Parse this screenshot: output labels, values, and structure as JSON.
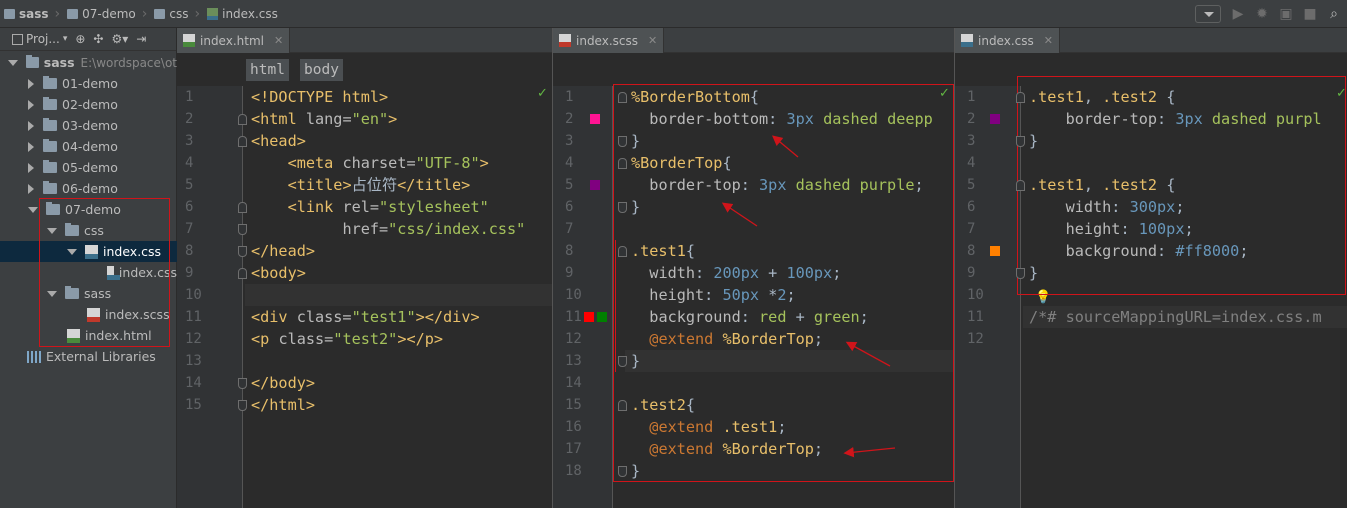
{
  "breadcrumbs": [
    "sass",
    "07-demo",
    "css",
    "index.css"
  ],
  "project": {
    "view_label": "Proj...",
    "root_name": "sass",
    "root_path": "E:\\wordspace\\ot",
    "nodes": [
      "01-demo",
      "02-demo",
      "03-demo",
      "04-demo",
      "05-demo",
      "06-demo",
      "07-demo",
      "css",
      "index.css",
      "index.css",
      "sass",
      "index.scss",
      "index.html",
      "External Libraries"
    ]
  },
  "html_editor": {
    "tab": "index.html",
    "tags": [
      "html",
      "body"
    ],
    "lines": [
      [
        [
          "tg",
          "<!DOCTYPE html>"
        ]
      ],
      [
        [
          "tg",
          "<html "
        ],
        [
          "at",
          "lang="
        ],
        [
          "st",
          "\"en\""
        ],
        [
          "tg",
          ">"
        ]
      ],
      [
        [
          "tg",
          "<head>"
        ]
      ],
      [
        [
          "sp",
          "    "
        ],
        [
          "tg",
          "<meta "
        ],
        [
          "at",
          "charset="
        ],
        [
          "st",
          "\"UTF-8\""
        ],
        [
          "tg",
          ">"
        ]
      ],
      [
        [
          "sp",
          "    "
        ],
        [
          "tg",
          "<title>"
        ],
        [
          "pl",
          "占位符"
        ],
        [
          "tg",
          "</title>"
        ]
      ],
      [
        [
          "sp",
          "    "
        ],
        [
          "tg",
          "<link "
        ],
        [
          "at",
          "rel="
        ],
        [
          "st",
          "\"stylesheet\""
        ]
      ],
      [
        [
          "sp",
          "          "
        ],
        [
          "at",
          "href="
        ],
        [
          "st",
          "\"css/index.css\""
        ]
      ],
      [
        [
          "tg",
          "</head>"
        ]
      ],
      [
        [
          "tg",
          "<body>"
        ]
      ],
      [],
      [
        [
          "tg",
          "<div "
        ],
        [
          "at",
          "class="
        ],
        [
          "st",
          "\"test1\""
        ],
        [
          "tg",
          "></div>"
        ]
      ],
      [
        [
          "tg",
          "<p "
        ],
        [
          "at",
          "class="
        ],
        [
          "st",
          "\"test2\""
        ],
        [
          "tg",
          "></p>"
        ]
      ],
      [],
      [
        [
          "tg",
          "</body>"
        ]
      ],
      [
        [
          "tg",
          "</html>"
        ]
      ]
    ]
  },
  "scss_editor": {
    "tab": "index.scss",
    "lines": [
      [
        [
          "sel",
          "%BorderBottom"
        ],
        [
          "pl",
          "{"
        ]
      ],
      [
        [
          "sp",
          "  "
        ],
        [
          "pr",
          "border-bottom"
        ],
        [
          "pl",
          ": "
        ],
        [
          "num",
          "3px"
        ],
        [
          "pl",
          " "
        ],
        [
          "st",
          "dashed deepp"
        ]
      ],
      [
        [
          "pl",
          "}"
        ]
      ],
      [
        [
          "sel",
          "%BorderTop"
        ],
        [
          "pl",
          "{"
        ]
      ],
      [
        [
          "sp",
          "  "
        ],
        [
          "pr",
          "border-top"
        ],
        [
          "pl",
          ": "
        ],
        [
          "num",
          "3px"
        ],
        [
          "pl",
          " "
        ],
        [
          "st",
          "dashed purple"
        ],
        [
          "pl",
          ";"
        ]
      ],
      [
        [
          "pl",
          "}"
        ]
      ],
      [],
      [
        [
          "sel",
          ".test1"
        ],
        [
          "pl",
          "{"
        ]
      ],
      [
        [
          "sp",
          "  "
        ],
        [
          "pr",
          "width"
        ],
        [
          "pl",
          ": "
        ],
        [
          "num",
          "200px"
        ],
        [
          "pl",
          " + "
        ],
        [
          "num",
          "100px"
        ],
        [
          "pl",
          ";"
        ]
      ],
      [
        [
          "sp",
          "  "
        ],
        [
          "pr",
          "height"
        ],
        [
          "pl",
          ": "
        ],
        [
          "num",
          "50px"
        ],
        [
          "pl",
          " *"
        ],
        [
          "num",
          "2"
        ],
        [
          "pl",
          ";"
        ]
      ],
      [
        [
          "sp",
          "  "
        ],
        [
          "pr",
          "background"
        ],
        [
          "pl",
          ": "
        ],
        [
          "st",
          "red"
        ],
        [
          "pl",
          " + "
        ],
        [
          "st",
          "green"
        ],
        [
          "pl",
          ";"
        ]
      ],
      [
        [
          "sp",
          "  "
        ],
        [
          "kw",
          "@extend"
        ],
        [
          "pl",
          " "
        ],
        [
          "sel",
          "%BorderTop"
        ],
        [
          "pl",
          ";"
        ]
      ],
      [
        [
          "pl",
          "}"
        ]
      ],
      [],
      [
        [
          "sel",
          ".test2"
        ],
        [
          "pl",
          "{"
        ]
      ],
      [
        [
          "sp",
          "  "
        ],
        [
          "kw",
          "@extend"
        ],
        [
          "pl",
          " "
        ],
        [
          "sel",
          ".test1"
        ],
        [
          "pl",
          ";"
        ]
      ],
      [
        [
          "sp",
          "  "
        ],
        [
          "kw",
          "@extend"
        ],
        [
          "pl",
          " "
        ],
        [
          "sel",
          "%BorderTop"
        ],
        [
          "pl",
          ";"
        ]
      ],
      [
        [
          "pl",
          "}"
        ]
      ]
    ]
  },
  "css_editor": {
    "tab": "index.css",
    "lines": [
      [
        [
          "sel",
          ".test1"
        ],
        [
          "pl",
          ", "
        ],
        [
          "sel",
          ".test2"
        ],
        [
          "pl",
          " {"
        ]
      ],
      [
        [
          "sp",
          "    "
        ],
        [
          "pr",
          "border-top"
        ],
        [
          "pl",
          ": "
        ],
        [
          "num",
          "3px"
        ],
        [
          "pl",
          " "
        ],
        [
          "st",
          "dashed purpl"
        ]
      ],
      [
        [
          "pl",
          "}"
        ]
      ],
      [],
      [
        [
          "sel",
          ".test1"
        ],
        [
          "pl",
          ", "
        ],
        [
          "sel",
          ".test2"
        ],
        [
          "pl",
          " {"
        ]
      ],
      [
        [
          "sp",
          "    "
        ],
        [
          "pr",
          "width"
        ],
        [
          "pl",
          ": "
        ],
        [
          "num",
          "300px"
        ],
        [
          "pl",
          ";"
        ]
      ],
      [
        [
          "sp",
          "    "
        ],
        [
          "pr",
          "height"
        ],
        [
          "pl",
          ": "
        ],
        [
          "num",
          "100px"
        ],
        [
          "pl",
          ";"
        ]
      ],
      [
        [
          "sp",
          "    "
        ],
        [
          "pr",
          "background"
        ],
        [
          "pl",
          ": "
        ],
        [
          "num",
          "#ff8000"
        ],
        [
          "pl",
          ";"
        ]
      ],
      [
        [
          "pl",
          "}"
        ]
      ],
      [],
      [
        [
          "cm",
          "/*# sourceMappingURL=index.css.m"
        ]
      ],
      []
    ]
  },
  "colors": {
    "swatch_deeppink": "#ff1493",
    "swatch_purple": "#800080",
    "swatch_red": "#ff0000",
    "swatch_green": "#008000",
    "swatch_orange": "#ff8000",
    "annotation_red": "#d0141a"
  }
}
